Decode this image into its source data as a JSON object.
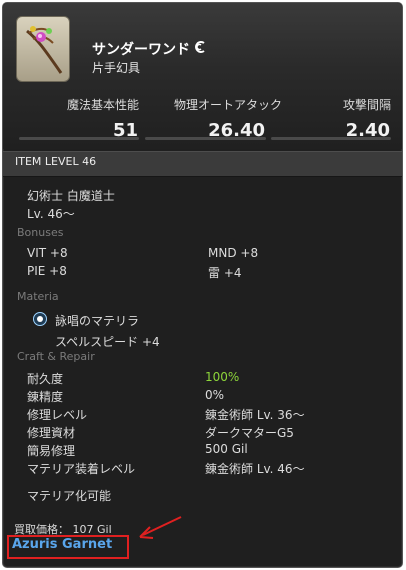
{
  "item": {
    "name": "サンダーワンド",
    "category": "片手幻具"
  },
  "stats": [
    {
      "label": "魔法基本性能",
      "value": "51"
    },
    {
      "label": "物理オートアタック",
      "value": "26.40"
    },
    {
      "label": "攻撃間隔",
      "value": "2.40"
    }
  ],
  "item_level": "ITEM LEVEL 46",
  "jobs": "幻術士 白魔道士",
  "level_req": "Lv. 46～",
  "bonuses": {
    "title": "Bonuses",
    "items": [
      "VIT +8",
      "MND +8",
      "PIE +8",
      "雷 +4"
    ]
  },
  "materia": {
    "title": "Materia",
    "name": "詠唱のマテリラ",
    "effect": "スペルスピード +4"
  },
  "craft": {
    "title": "Craft & Repair",
    "rows": [
      {
        "label": "耐久度",
        "value": "100%"
      },
      {
        "label": "錬精度",
        "value": "0%"
      },
      {
        "label": "修理レベル",
        "value": "錬金術師 Lv. 36～"
      },
      {
        "label": "修理資材",
        "value": "ダークマターG5"
      },
      {
        "label": "簡易修理",
        "value": "500 Gil"
      },
      {
        "label": "マテリア装着レベル",
        "value": "錬金術師 Lv. 46～"
      }
    ],
    "extract": "マテリア化可能"
  },
  "sell_price": "買取価格： 107 Gil",
  "server_name": "Azuris Garnet",
  "colors": {
    "accent_green": "#8dd63a",
    "link_blue": "#5aa6ec",
    "highlight_red": "#e02020"
  }
}
